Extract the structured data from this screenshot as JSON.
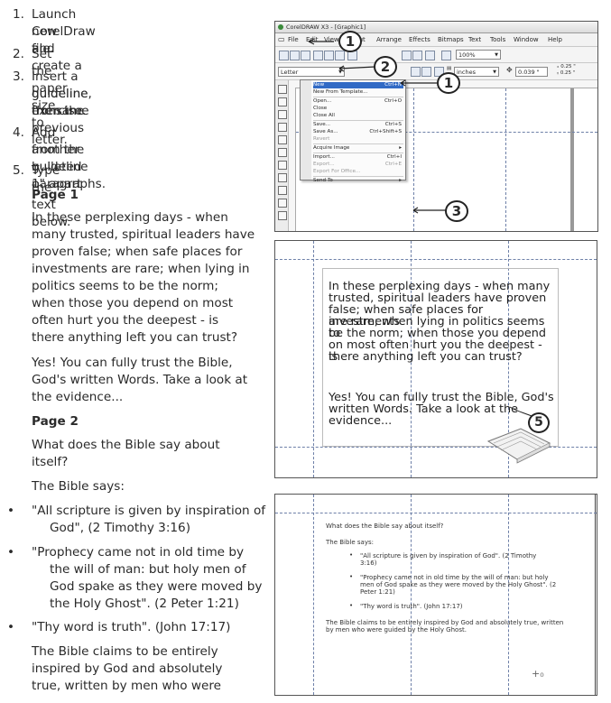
{
  "instructions": {
    "steps": [
      {
        "num": "1.",
        "lines": [
          "Launch CorelDraw and create a",
          "new file."
        ]
      },
      {
        "num": "2.",
        "lines": [
          "Set the paper size to letter."
        ]
      },
      {
        "num": "3.",
        "lines": [
          "Insert a guideline, the same",
          "guideline from the previous",
          "exercise."
        ]
      },
      {
        "num": "4.",
        "lines": [
          "Add another guideline 1\" apart",
          "from the   bulleted paragraphs."
        ]
      },
      {
        "num": "5.",
        "lines": [
          "Type the text below."
        ]
      }
    ],
    "page1_heading": "Page 1",
    "page1_para1": [
      "In these perplexing days - when",
      "many trusted, spiritual leaders have",
      "proven false; when safe places for",
      "investments are rare; when lying in",
      "politics seems to be the norm;",
      "when those you depend on most",
      "often hurt you the deepest - is",
      "there anything left you can trust?"
    ],
    "page1_para2": [
      "Yes! You can fully trust the Bible,",
      "God's written Words. Take a look at",
      "the evidence..."
    ],
    "page2_heading": "Page 2",
    "page2_q": [
      "What does the Bible say about",
      "itself?"
    ],
    "page2_says": "The Bible says:",
    "bullets": [
      {
        "lines": [
          "\"All scripture is given by inspiration of",
          "God\", (2 Timothy 3:16)"
        ]
      },
      {
        "lines": [
          "\"Prophecy came not in old time by",
          "the will of man: but holy men of",
          "God spake as they were moved by",
          "the Holy Ghost\". (2 Peter 1:21)"
        ]
      },
      {
        "lines": [
          "\"Thy word is truth\". (John 17:17)"
        ]
      }
    ],
    "closing": [
      "The Bible claims to be entirely",
      "inspired by God and absolutely",
      "true, written by men who were",
      "guided by the Holy Ghost."
    ]
  },
  "corel": {
    "title": "CorelDRAW X3 - [Graphic1]",
    "menus": [
      "File",
      "Edit",
      "View",
      "Layout",
      "Arrange",
      "Effects",
      "Bitmaps",
      "Text",
      "Tools",
      "Window",
      "Help"
    ],
    "zoom": "100%",
    "paper": "Letter",
    "units": "inches",
    "nudge": "0.039 \"",
    "dup_x": "0.25 \"",
    "dup_y": "0.25 \"",
    "file_menu": [
      {
        "label": "New",
        "shortcut": "Ctrl+N",
        "state": "hl"
      },
      {
        "label": "New From Template...",
        "shortcut": "",
        "state": ""
      },
      {
        "label": "Open...",
        "shortcut": "Ctrl+O",
        "state": ""
      },
      {
        "label": "Close",
        "shortcut": "",
        "state": ""
      },
      {
        "label": "Close All",
        "shortcut": "",
        "state": ""
      },
      {
        "label": "Save...",
        "shortcut": "Ctrl+S",
        "state": ""
      },
      {
        "label": "Save As...",
        "shortcut": "Ctrl+Shift+S",
        "state": ""
      },
      {
        "label": "Revert",
        "shortcut": "",
        "state": "dis"
      },
      {
        "label": "Acquire Image",
        "shortcut": "▸",
        "state": ""
      },
      {
        "label": "Import...",
        "shortcut": "Ctrl+I",
        "state": ""
      },
      {
        "label": "Export...",
        "shortcut": "Ctrl+E",
        "state": "dis"
      },
      {
        "label": "Export For Office...",
        "shortcut": "",
        "state": "dis"
      },
      {
        "label": "Send To",
        "shortcut": "▸",
        "state": ""
      }
    ]
  },
  "callouts": {
    "c1": "1",
    "c2": "2",
    "c3": "3",
    "c5": "5"
  },
  "page_preview1": {
    "para1": [
      "In these perplexing days - when many",
      "trusted, spiritual leaders have proven",
      "false; when safe places for investments",
      "are rare; when lying in politics seems to",
      "be the norm; when those you depend",
      "on most often hurt you the deepest - is",
      "there anything left you can trust?"
    ],
    "para2": [
      "Yes! You can fully trust the Bible, God's",
      "written Words. Take a look at the",
      "evidence..."
    ]
  },
  "page_preview2": {
    "q": "What does the Bible say about itself?",
    "says": "The Bible says:",
    "b1": [
      "\"All scripture is given by inspiration of God\". (2 Timothy",
      "3:16)"
    ],
    "b2": [
      "\"Prophecy came not in old time by the will of man: but holy",
      "men of God spake as they were moved by the Holy Ghost\". (2",
      "Peter 1:21)"
    ],
    "b3": "\"Thy word is truth\". (John 17:17)",
    "closing": [
      "The Bible claims to be entirely inspired by God and absolutely true, written",
      "by men who were guided by the Holy Ghost."
    ]
  }
}
